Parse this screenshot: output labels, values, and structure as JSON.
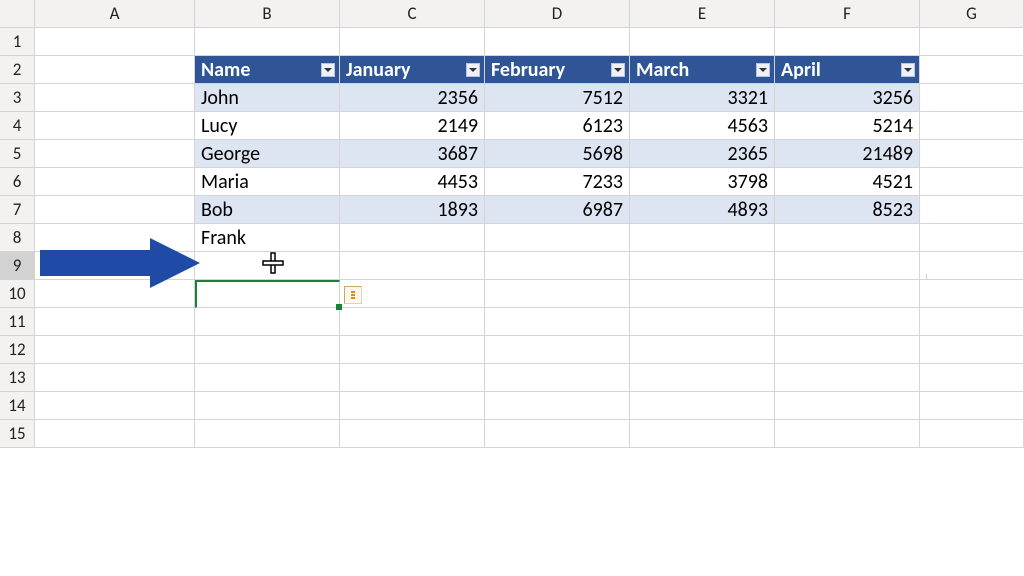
{
  "columns": [
    "A",
    "B",
    "C",
    "D",
    "E",
    "F",
    "G"
  ],
  "rows": [
    "1",
    "2",
    "3",
    "4",
    "5",
    "6",
    "7",
    "8",
    "9",
    "10",
    "11",
    "12",
    "13",
    "14",
    "15"
  ],
  "active_row_index": 8,
  "table": {
    "headers": [
      "Name",
      "January",
      "February",
      "March",
      "April"
    ],
    "rows": [
      {
        "name": "John",
        "vals": [
          "2356",
          "7512",
          "3321",
          "3256"
        ]
      },
      {
        "name": "Lucy",
        "vals": [
          "2149",
          "6123",
          "4563",
          "5214"
        ]
      },
      {
        "name": "George",
        "vals": [
          "3687",
          "5698",
          "2365",
          "21489"
        ]
      },
      {
        "name": "Maria",
        "vals": [
          "4453",
          "7233",
          "3798",
          "4521"
        ]
      },
      {
        "name": "Bob",
        "vals": [
          "1893",
          "6987",
          "4893",
          "8523"
        ]
      }
    ],
    "new_row_name": "Frank"
  },
  "icons": {
    "filter": "filter-dropdown-icon",
    "autofill": "autofill-options-icon",
    "arrow": "annotation-arrow-icon",
    "cursor": "cell-cursor-icon"
  },
  "colors": {
    "header_bg": "#2f5597",
    "band_bg": "#dde4f2",
    "row_hdr_bg": "#f3f2f1",
    "active_border": "#1a7f37",
    "arrow": "#1f4aa5"
  },
  "chart_data": {
    "type": "table",
    "title": "",
    "columns": [
      "Name",
      "January",
      "February",
      "March",
      "April"
    ],
    "rows": [
      [
        "John",
        2356,
        7512,
        3321,
        3256
      ],
      [
        "Lucy",
        2149,
        6123,
        4563,
        5214
      ],
      [
        "George",
        3687,
        5698,
        2365,
        21489
      ],
      [
        "Maria",
        4453,
        7233,
        3798,
        4521
      ],
      [
        "Bob",
        1893,
        6987,
        4893,
        8523
      ],
      [
        "Frank",
        null,
        null,
        null,
        null
      ]
    ]
  }
}
